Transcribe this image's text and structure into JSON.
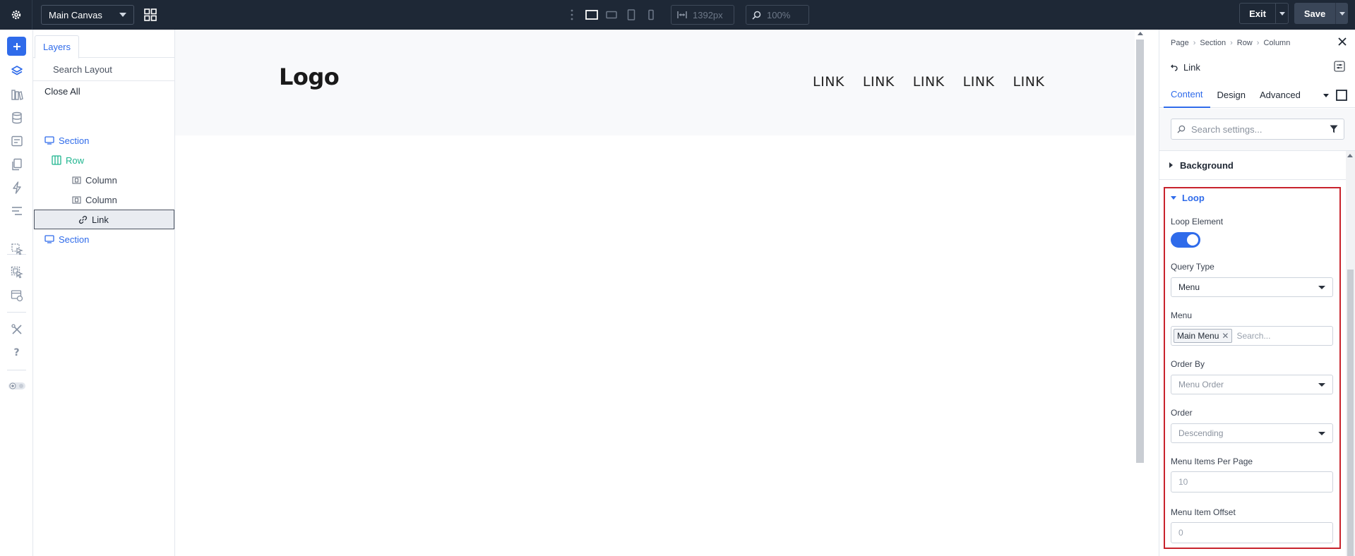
{
  "topbar": {
    "canvas_select": "Main Canvas",
    "width_readout": "1392px",
    "zoom_readout": "100%",
    "exit_label": "Exit",
    "save_label": "Save"
  },
  "layers": {
    "tab_label": "Layers",
    "search_placeholder": "Search Layout",
    "close_all": "Close All",
    "tree": [
      {
        "label": "Section"
      },
      {
        "label": "Row"
      },
      {
        "label": "Column"
      },
      {
        "label": "Column"
      },
      {
        "label": "Link"
      },
      {
        "label": "Section"
      }
    ]
  },
  "canvas": {
    "logo": "Logo",
    "nav_links": [
      "LINK",
      "LINK",
      "LINK",
      "LINK",
      "LINK"
    ]
  },
  "panel": {
    "breadcrumb": [
      "Page",
      "Section",
      "Row",
      "Column"
    ],
    "element_title": "Link",
    "tabs": [
      "Content",
      "Design",
      "Advanced"
    ],
    "search_placeholder": "Search settings...",
    "background_label": "Background",
    "loop": {
      "title": "Loop",
      "loop_element_label": "Loop Element",
      "loop_element_enabled": true,
      "query_type_label": "Query Type",
      "query_type_value": "Menu",
      "menu_label": "Menu",
      "menu_tag": "Main Menu",
      "menu_search_placeholder": "Search...",
      "order_by_label": "Order By",
      "order_by_value": "Menu Order",
      "order_label": "Order",
      "order_value": "Descending",
      "items_per_page_label": "Menu Items Per Page",
      "items_per_page_placeholder": "10",
      "item_offset_label": "Menu Item Offset",
      "item_offset_placeholder": "0"
    }
  },
  "colors": {
    "topbar_bg": "#1e2836",
    "accent": "#2f6bea",
    "row_green": "#1fb58f",
    "highlight_red": "#c8232c"
  }
}
